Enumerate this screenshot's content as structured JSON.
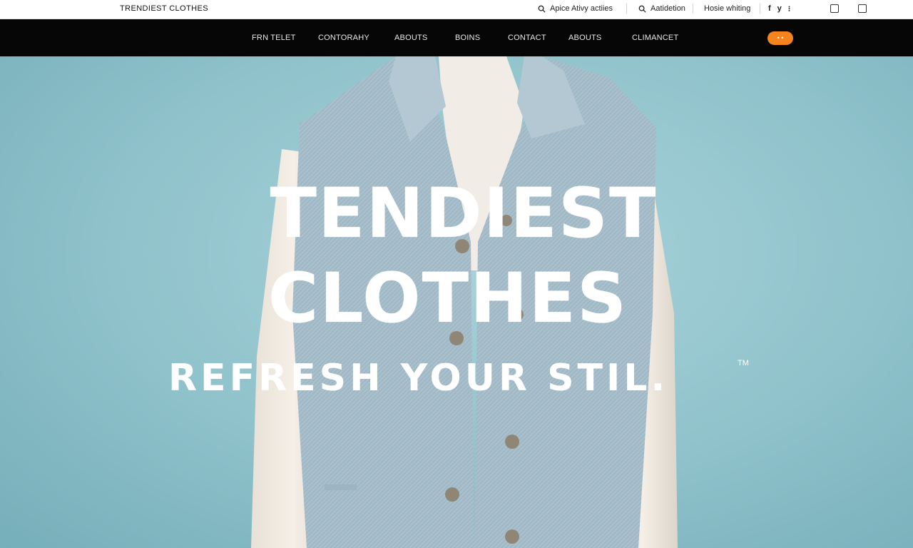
{
  "brand": "TRENDIEST CLOTHES",
  "utility": {
    "search_text": "Apice Ativy actiies",
    "search2_text": "Aatidetion",
    "link_text": "Hosie whiting",
    "social": [
      "f",
      "y",
      "⁝"
    ]
  },
  "nav": {
    "items": [
      "FRN TELET",
      "CONTORAHY",
      "ABOUTS",
      "BOINS",
      "CONTACT",
      "ABOUTS",
      "CLIMANCET"
    ],
    "cart_label": "• •"
  },
  "hero": {
    "title_line1": "TENDIEST",
    "title_line2": "CLOTHES",
    "tagline": "REFRESH YOUR STIL.",
    "trademark": "TM"
  },
  "colors": {
    "nav_bg": "#060606",
    "accent": "#f5841f",
    "hero_bg": "#8fc2cb",
    "shirt": "#a7bfcb",
    "sleeve": "#efe8df"
  },
  "icons": {
    "search": "search-icon",
    "edit": "edit-icon",
    "instagram": "instagram-icon"
  }
}
